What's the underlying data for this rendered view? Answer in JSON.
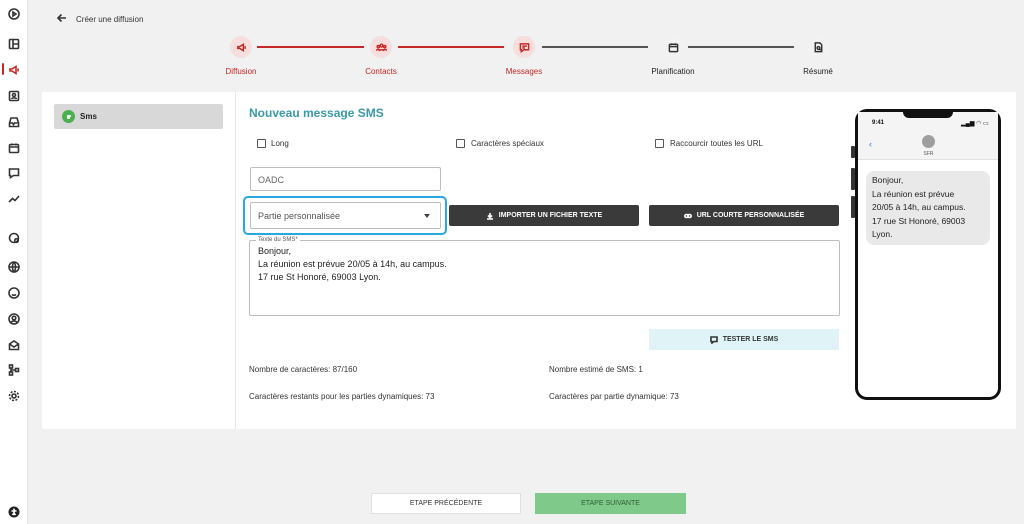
{
  "header": {
    "title": "Créer une diffusion"
  },
  "stepper": {
    "steps": [
      {
        "label": "Diffusion",
        "state": "done",
        "icon": "megaphone-icon"
      },
      {
        "label": "Contacts",
        "state": "done",
        "icon": "users-icon"
      },
      {
        "label": "Messages",
        "state": "done",
        "icon": "message-icon"
      },
      {
        "label": "Planification",
        "state": "todo",
        "icon": "calendar-icon"
      },
      {
        "label": "Résumé",
        "state": "todo",
        "icon": "document-search-icon"
      }
    ],
    "done_color": "#c62828",
    "todo_color": "#555555"
  },
  "left_panel": {
    "channel_tab": "Sms"
  },
  "form": {
    "title": "Nouveau message SMS",
    "options": [
      {
        "label": "Long",
        "checked": false
      },
      {
        "label": "Caractères spéciaux",
        "checked": false
      },
      {
        "label": "Raccourcir toutes les URL",
        "checked": false
      }
    ],
    "oadc_placeholder": "OADC",
    "personalized_select": "Partie personnalisée",
    "import_button": "IMPORTER UN FICHIER TEXTE",
    "short_url_button": "URL COURTE PERSONNALISÉE",
    "sms_text_label": "Texte du SMS*",
    "sms_text_lines": [
      "Bonjour,",
      "La réunion est prévue 20/05 à 14h, au campus.",
      "17 rue St Honoré, 69003 Lyon."
    ],
    "test_button": "TESTER LE SMS",
    "char_count": "Nombre de caractères: 87/160",
    "sms_count": "Nombre estimé de SMS: 1",
    "remaining_chars": "Caractères restants pour les parties dynamiques: 73",
    "chars_per_part": "Caractères par partie dynamique: 73"
  },
  "phone_preview": {
    "time": "9:41",
    "sender": "SFR",
    "message_lines": [
      "Bonjour,",
      "La réunion est prévue",
      "20/05 à 14h, au campus.",
      "17 rue St Honoré, 69003",
      "Lyon."
    ]
  },
  "footer": {
    "prev_button": "ETAPE PRÉCÉDENTE",
    "next_button": "ETAPE SUIVANTE"
  },
  "colors": {
    "accent": "#c62828",
    "title_teal": "#3a9aa8",
    "next_green": "#7fc98a",
    "focus_blue": "#29a8e0"
  }
}
